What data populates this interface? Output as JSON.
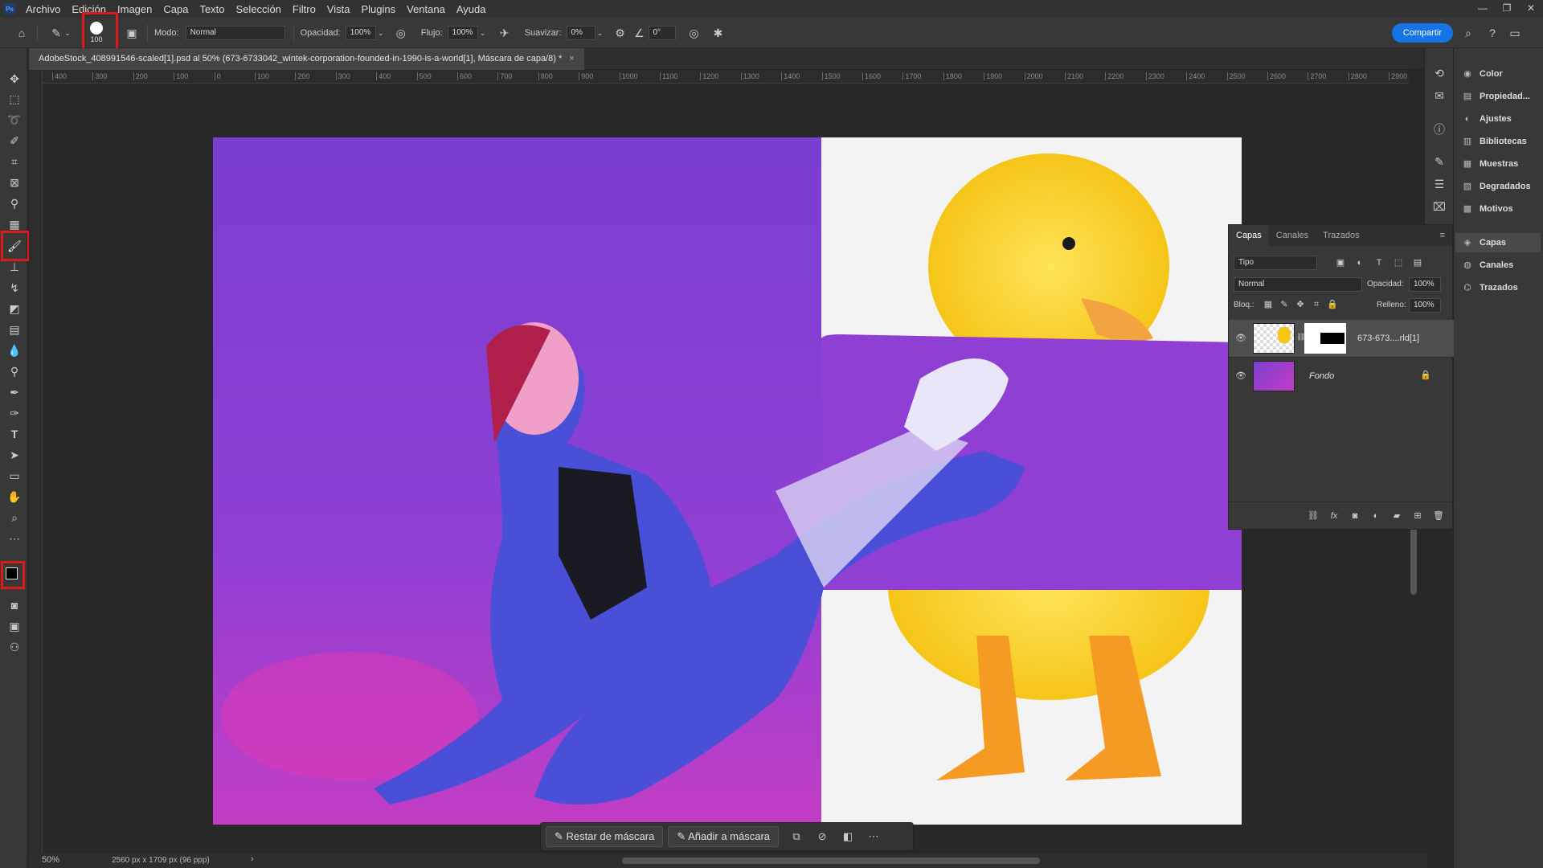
{
  "menu": {
    "items": [
      "Archivo",
      "Edición",
      "Imagen",
      "Capa",
      "Texto",
      "Selección",
      "Filtro",
      "Vista",
      "Plugins",
      "Ventana",
      "Ayuda"
    ]
  },
  "options": {
    "brush_size": "100",
    "mode_label": "Modo:",
    "mode_value": "Normal",
    "opacity_label": "Opacidad:",
    "opacity_value": "100%",
    "flow_label": "Flujo:",
    "flow_value": "100%",
    "smooth_label": "Suavizar:",
    "smooth_value": "0%",
    "angle_value": "0°",
    "share_label": "Compartir"
  },
  "document": {
    "tab_title": "AdobeStock_408991546-scaled[1].psd al 50% (673-6733042_wintek-corporation-founded-in-1990-is-a-world[1], Máscara de capa/8) *",
    "zoom": "50%",
    "dimensions": "2560 px x 1709 px (96 ppp)"
  },
  "ruler": {
    "h_ticks": [
      "400",
      "300",
      "200",
      "100",
      "0",
      "100",
      "200",
      "300",
      "400",
      "500",
      "600",
      "700",
      "800",
      "900",
      "1000",
      "1100",
      "1200",
      "1300",
      "1400",
      "1500",
      "1600",
      "1700",
      "1800",
      "1900",
      "2000",
      "2100",
      "2200",
      "2300",
      "2400",
      "2500",
      "2600",
      "2700",
      "2800",
      "2900"
    ]
  },
  "mask_bar": {
    "subtract_label": "Restar de máscara",
    "add_label": "Añadir a máscara"
  },
  "dock": {
    "items": [
      "Color",
      "Propiedad...",
      "Ajustes",
      "Bibliotecas",
      "Muestras",
      "Degradados",
      "Motivos",
      "Capas",
      "Canales",
      "Trazados"
    ]
  },
  "layers_panel": {
    "tabs": [
      "Capas",
      "Canales",
      "Trazados"
    ],
    "filter_value": "Tipo",
    "blend_mode": "Normal",
    "opacity_label": "Opacidad:",
    "opacity_value": "100%",
    "lock_label": "Bloq.:",
    "fill_label": "Relleno:",
    "fill_value": "100%",
    "layers": [
      {
        "name": "673-673....rld[1]"
      },
      {
        "name": "Fondo"
      }
    ]
  },
  "colors": {
    "accent": "#1473e6",
    "highlight": "#e01a1a",
    "purple": "#8a3fd1"
  }
}
